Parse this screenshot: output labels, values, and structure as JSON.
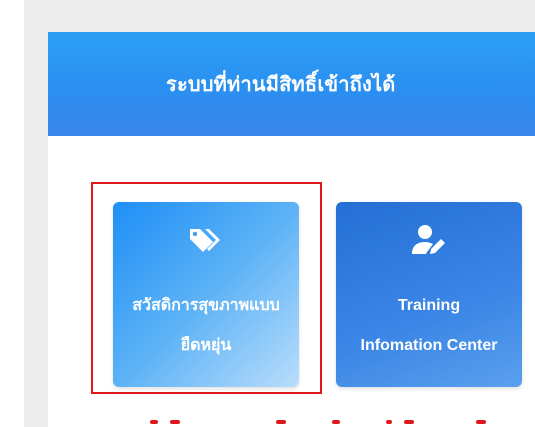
{
  "panel": {
    "title": "ระบบที่ท่านมีสิทธิ์เข้าถึงได้"
  },
  "tiles": [
    {
      "icon": "tags-icon",
      "line1": "สวัสดิการสุขภาพแบบ",
      "line2": "ยืดหยุ่น",
      "highlighted": true
    },
    {
      "icon": "user-edit-icon",
      "line1": "Training",
      "line2": "Infomation Center",
      "highlighted": false
    }
  ],
  "colors": {
    "header_blue": "#2a8ff0",
    "highlight_red": "#e0191f",
    "frame_gray": "#ececec"
  }
}
